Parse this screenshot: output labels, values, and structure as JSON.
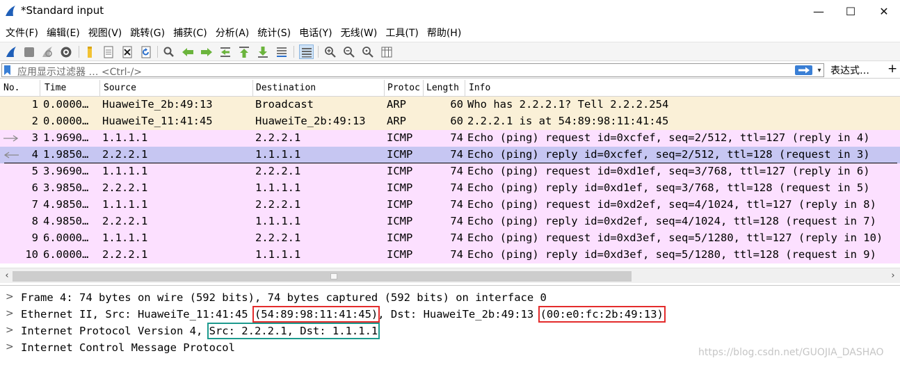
{
  "window": {
    "title": "*Standard input",
    "minimize_glyph": "—",
    "maximize_glyph": "☐",
    "close_glyph": "✕"
  },
  "menu": [
    "文件(F)",
    "编辑(E)",
    "视图(V)",
    "跳转(G)",
    "捕获(C)",
    "分析(A)",
    "统计(S)",
    "电话(Y)",
    "无线(W)",
    "工具(T)",
    "帮助(H)"
  ],
  "toolbar": {
    "icons": [
      "start-capture-icon",
      "stop-capture-icon",
      "restart-capture-icon",
      "capture-options-icon",
      "open-file-icon",
      "save-file-icon",
      "close-file-icon",
      "reload-file-icon",
      "find-packet-icon",
      "go-back-icon",
      "go-forward-icon",
      "go-to-packet-icon",
      "go-first-icon",
      "go-last-icon",
      "autoscroll-icon",
      "colorize-icon",
      "zoom-in-icon",
      "zoom-out-icon",
      "zoom-normal-icon",
      "resize-columns-icon"
    ]
  },
  "filter": {
    "placeholder": "应用显示过滤器 … <Ctrl-/>",
    "dropdown_glyph": "▾",
    "expression_label": "表达式…",
    "add_glyph": "+"
  },
  "packet_list": {
    "columns": [
      "No.",
      "Time",
      "Source",
      "Destination",
      "Protoc",
      "Length",
      "Info"
    ],
    "rows": [
      {
        "no": "1",
        "time": "0.0000…",
        "source": "HuaweiTe_2b:49:13",
        "destination": "Broadcast",
        "protocol": "ARP",
        "length": "60",
        "info": "Who has 2.2.2.1? Tell 2.2.2.254",
        "color": "#faf0d7",
        "marker": ""
      },
      {
        "no": "2",
        "time": "0.0000…",
        "source": "HuaweiTe_11:41:45",
        "destination": "HuaweiTe_2b:49:13",
        "protocol": "ARP",
        "length": "60",
        "info": "2.2.2.1 is at 54:89:98:11:41:45",
        "color": "#faf0d7",
        "marker": ""
      },
      {
        "no": "3",
        "time": "1.9690…",
        "source": "1.1.1.1",
        "destination": "2.2.2.1",
        "protocol": "ICMP",
        "length": "74",
        "info": "Echo (ping) request  id=0xcfef, seq=2/512, ttl=127 (reply in 4)",
        "color": "#fce0ff",
        "marker": "request"
      },
      {
        "no": "4",
        "time": "1.9850…",
        "source": "2.2.2.1",
        "destination": "1.1.1.1",
        "protocol": "ICMP",
        "length": "74",
        "info": "Echo (ping) reply    id=0xcfef, seq=2/512, ttl=128 (request in 3)",
        "color": "#c6c6f2",
        "marker": "reply"
      },
      {
        "no": "5",
        "time": "3.9690…",
        "source": "1.1.1.1",
        "destination": "2.2.2.1",
        "protocol": "ICMP",
        "length": "74",
        "info": "Echo (ping) request  id=0xd1ef, seq=3/768, ttl=127 (reply in 6)",
        "color": "#fce0ff",
        "marker": ""
      },
      {
        "no": "6",
        "time": "3.9850…",
        "source": "2.2.2.1",
        "destination": "1.1.1.1",
        "protocol": "ICMP",
        "length": "74",
        "info": "Echo (ping) reply    id=0xd1ef, seq=3/768, ttl=128 (request in 5)",
        "color": "#fce0ff",
        "marker": ""
      },
      {
        "no": "7",
        "time": "4.9850…",
        "source": "1.1.1.1",
        "destination": "2.2.2.1",
        "protocol": "ICMP",
        "length": "74",
        "info": "Echo (ping) request  id=0xd2ef, seq=4/1024, ttl=127 (reply in 8)",
        "color": "#fce0ff",
        "marker": ""
      },
      {
        "no": "8",
        "time": "4.9850…",
        "source": "2.2.2.1",
        "destination": "1.1.1.1",
        "protocol": "ICMP",
        "length": "74",
        "info": "Echo (ping) reply    id=0xd2ef, seq=4/1024, ttl=128 (request in 7)",
        "color": "#fce0ff",
        "marker": ""
      },
      {
        "no": "9",
        "time": "6.0000…",
        "source": "1.1.1.1",
        "destination": "2.2.2.1",
        "protocol": "ICMP",
        "length": "74",
        "info": "Echo (ping) request  id=0xd3ef, seq=5/1280, ttl=127 (reply in 10)",
        "color": "#fce0ff",
        "marker": ""
      },
      {
        "no": "10",
        "time": "6.0000…",
        "source": "2.2.2.1",
        "destination": "1.1.1.1",
        "protocol": "ICMP",
        "length": "74",
        "info": "Echo (ping) reply    id=0xd3ef, seq=5/1280, ttl=128 (request in 9)",
        "color": "#fce0ff",
        "marker": ""
      }
    ]
  },
  "scrollbar": {
    "left_glyph": "‹",
    "right_glyph": "›"
  },
  "details": {
    "expand_glyph": ">",
    "frame": "Frame 4: 74 bytes on wire (592 bits), 74 bytes captured (592 bits) on interface 0",
    "eth_prefix": "Ethernet II, Src: HuaweiTe_11:41:45 ",
    "eth_src_mac": "(54:89:98:11:41:45)",
    "eth_mid": ", Dst: HuaweiTe_2b:49:13 ",
    "eth_dst_mac": "(00:e0:fc:2b:49:13)",
    "ip_prefix": "Internet Protocol Version 4, ",
    "ip_addrs": "Src: 2.2.2.1, Dst: 1.1.1.1",
    "icmp": "Internet Control Message Protocol",
    "watermark": "https://blog.csdn.net/GUOJIA_DASHAO"
  }
}
